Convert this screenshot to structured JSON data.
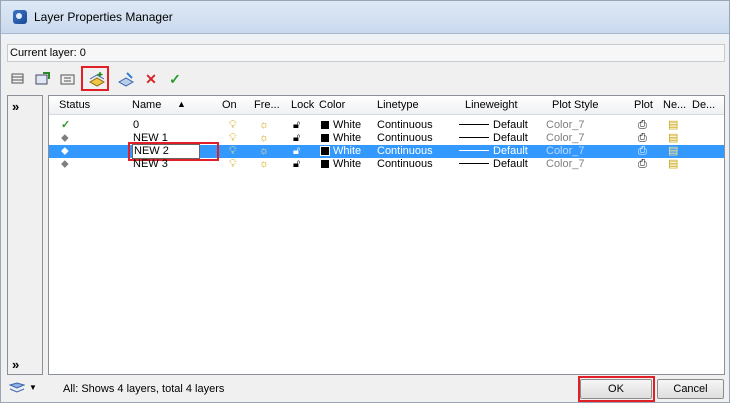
{
  "window": {
    "title": "Layer Properties Manager"
  },
  "current_layer": "Current layer: 0",
  "columns": [
    "Status",
    "Name",
    "On",
    "Fre...",
    "Lock",
    "Color",
    "Linetype",
    "Lineweight",
    "Plot Style",
    "Plot",
    "Ne...",
    "De..."
  ],
  "sort_indicator": "▲",
  "rows": [
    {
      "status": "check-icon",
      "name": "0",
      "color": "White",
      "linetype": "Continuous",
      "lineweight": "Default",
      "plotstyle": "Color_7"
    },
    {
      "status": "layer-icon",
      "name": "NEW 1",
      "color": "White",
      "linetype": "Continuous",
      "lineweight": "Default",
      "plotstyle": "Color_7"
    },
    {
      "status": "layer-icon",
      "name": "NEW 2",
      "color": "White",
      "linetype": "Continuous",
      "lineweight": "Default",
      "plotstyle": "Color_7",
      "selected": true
    },
    {
      "status": "layer-icon",
      "name": "NEW 3",
      "color": "White",
      "linetype": "Continuous",
      "lineweight": "Default",
      "plotstyle": "Color_7"
    }
  ],
  "status_bar": {
    "message": "All: Shows 4 layers, total 4 layers"
  },
  "buttons": {
    "ok": "OK",
    "cancel": "Cancel"
  },
  "left_pane": {
    "expand_top": "»",
    "expand_bottom": "»"
  },
  "colors": {
    "selection": "#3399ff",
    "highlight_box": "#e01f26"
  }
}
